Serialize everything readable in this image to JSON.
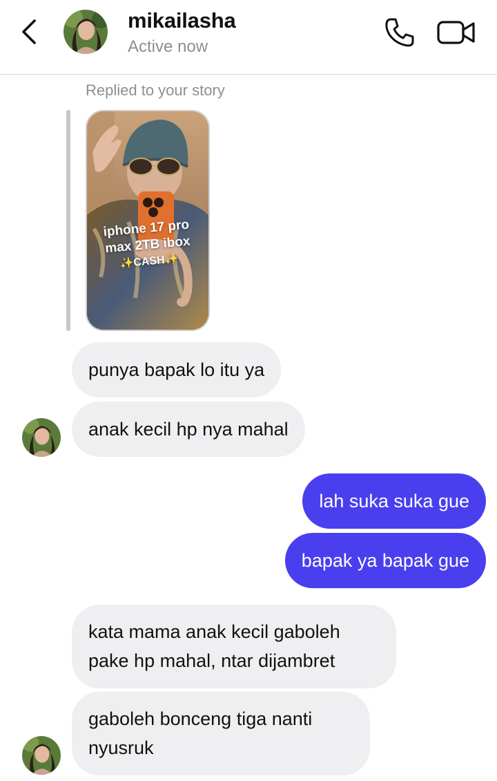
{
  "header": {
    "back_icon": "chevron-left-icon",
    "contact_name": "mikailasha",
    "status": "Active now",
    "call_icon": "phone-icon",
    "video_icon": "video-camera-icon"
  },
  "story_reply": {
    "caption": "Replied to your story",
    "story_text_line1": "iphone 17 pro",
    "story_text_line2": "max 2TB ibox",
    "story_text_line3": "✨CASH✨"
  },
  "messages": [
    {
      "sender": "them",
      "text": "punya bapak lo itu ya"
    },
    {
      "sender": "them",
      "text": "anak kecil hp nya mahal"
    },
    {
      "sender": "me",
      "text": "lah suka suka gue"
    },
    {
      "sender": "me",
      "text": "bapak ya bapak gue"
    },
    {
      "sender": "them",
      "text_line1": "kata mama anak kecil gaboleh",
      "text_line2": "pake hp mahal, ntar dijambret"
    },
    {
      "sender": "them",
      "text_line1": "gaboleh bonceng tiga nanti",
      "text_line2": "nyusruk"
    }
  ],
  "colors": {
    "outgoing_bubble": "#4a3fef",
    "incoming_bubble": "#efeff1",
    "secondary_text": "#8e8e93"
  }
}
